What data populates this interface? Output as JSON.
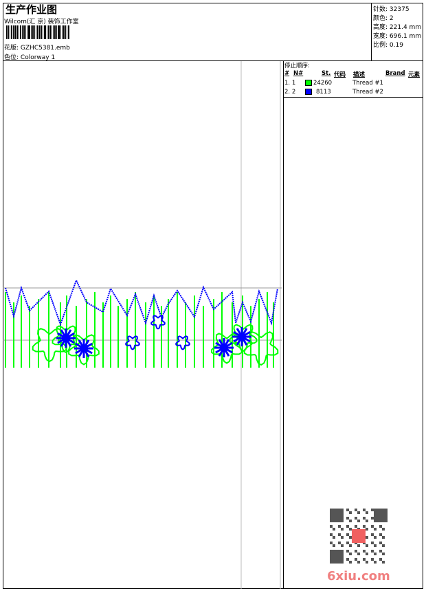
{
  "header": {
    "title": "生产作业图",
    "company": "Wilcom(汇 京) 装饰工作室",
    "design_label": "花版:",
    "design_value": "GZHC5381.emb",
    "colorway_label": "色位:",
    "colorway_value": "Colorway 1"
  },
  "stats": [
    {
      "label": "针数:",
      "value": "32375"
    },
    {
      "label": "颜色:",
      "value": "2"
    },
    {
      "label": "高度:",
      "value": "221.4 mm"
    },
    {
      "label": "宽度:",
      "value": "696.1 mm"
    },
    {
      "label": "比例:",
      "value": "0.19"
    }
  ],
  "stop_sequence": {
    "title": "停止顺序:",
    "columns": [
      "#",
      "N#",
      "St.",
      "代码",
      "描述",
      "Brand",
      "元素"
    ],
    "rows": [
      {
        "idx": "1.",
        "n": "1",
        "color": "#00ff00",
        "stitches": "24260",
        "desc": "Thread #1"
      },
      {
        "idx": "2.",
        "n": "2",
        "color": "#0000ff",
        "stitches": "8113",
        "desc": "Thread #2"
      }
    ]
  },
  "watermark": "6xiu.com",
  "colors": {
    "thread1": "#00ff00",
    "thread2": "#0000ff",
    "guide": "#ff0000"
  }
}
